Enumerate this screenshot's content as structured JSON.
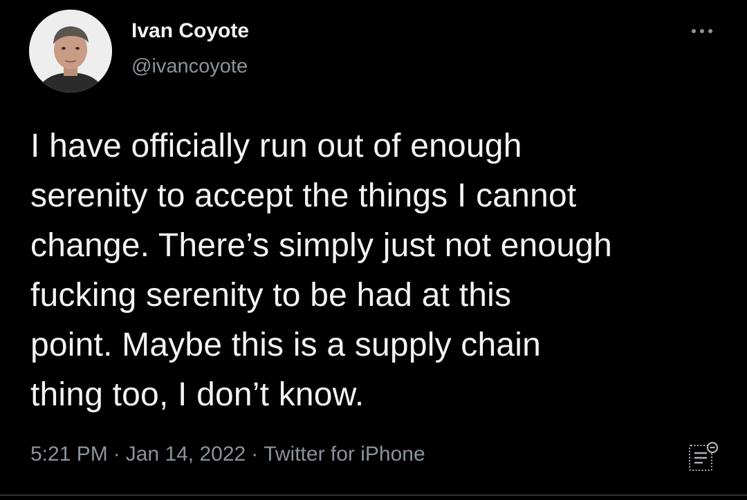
{
  "tweet": {
    "author": {
      "display_name": "Ivan Coyote",
      "handle": "@ivancoyote",
      "avatar_icon": "profile-photo"
    },
    "text_lines": [
      "I have officially run out of enough",
      "serenity to accept the things I cannot",
      "change. There’s simply just not enough",
      "fucking serenity to be had at this",
      "point. Maybe this is a supply chain",
      "thing too, I don’t know."
    ],
    "time": "5:21 PM",
    "separator": "·",
    "date": "Jan 14, 2022",
    "source": "Twitter for iPhone",
    "icons": {
      "more": "more-options-icon",
      "analytics": "analytics-icon"
    }
  },
  "colors": {
    "background": "#000000",
    "primary_text": "#e7e9ea",
    "secondary_text": "#8b949b",
    "divider": "#2f3336"
  }
}
